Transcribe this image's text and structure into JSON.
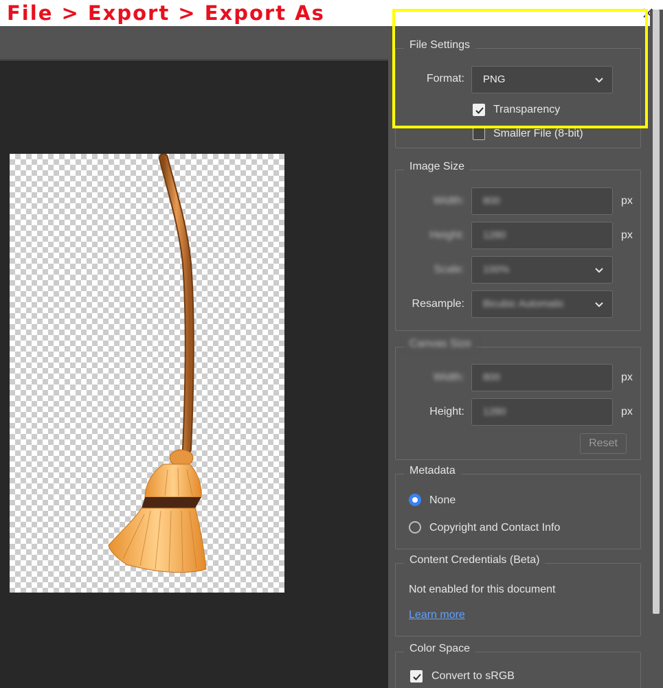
{
  "window": {
    "title": "File > Export > Export As"
  },
  "colors": {
    "accent": "#3b82f6",
    "highlight": "#ffff00",
    "title": "#e8101f",
    "link": "#5ea2ff"
  },
  "icons": {
    "close": "close-icon",
    "dropdown": "chevron-down-icon",
    "checkmark": "checkmark-icon"
  },
  "file_settings": {
    "title": "File Settings",
    "format_label": "Format:",
    "format_value": "PNG",
    "transparency_label": "Transparency",
    "transparency_checked": true,
    "smaller_file_label": "Smaller File (8-bit)",
    "smaller_file_checked": false
  },
  "image_size": {
    "title": "Image Size",
    "width_label": "Width:",
    "width_value": "800",
    "width_unit": "px",
    "height_label": "Height:",
    "height_value": "1280",
    "height_unit": "px",
    "scale_label": "Scale:",
    "scale_value": "100%",
    "resample_label": "Resample:",
    "resample_value": "Bicubic Automatic"
  },
  "canvas_size": {
    "title": "Canvas Size",
    "width_label": "Width:",
    "width_value": "800",
    "width_unit": "px",
    "height_label": "Height:",
    "height_value": "1280",
    "height_unit": "px",
    "reset_label": "Reset"
  },
  "metadata": {
    "title": "Metadata",
    "options": [
      {
        "label": "None",
        "selected": true
      },
      {
        "label": "Copyright and Contact Info",
        "selected": false
      }
    ]
  },
  "content_credentials": {
    "title": "Content Credentials (Beta)",
    "status_text": "Not enabled for this document",
    "learn_more_label": "Learn more"
  },
  "color_space": {
    "title": "Color Space",
    "convert_label": "Convert to sRGB",
    "convert_checked": true
  }
}
